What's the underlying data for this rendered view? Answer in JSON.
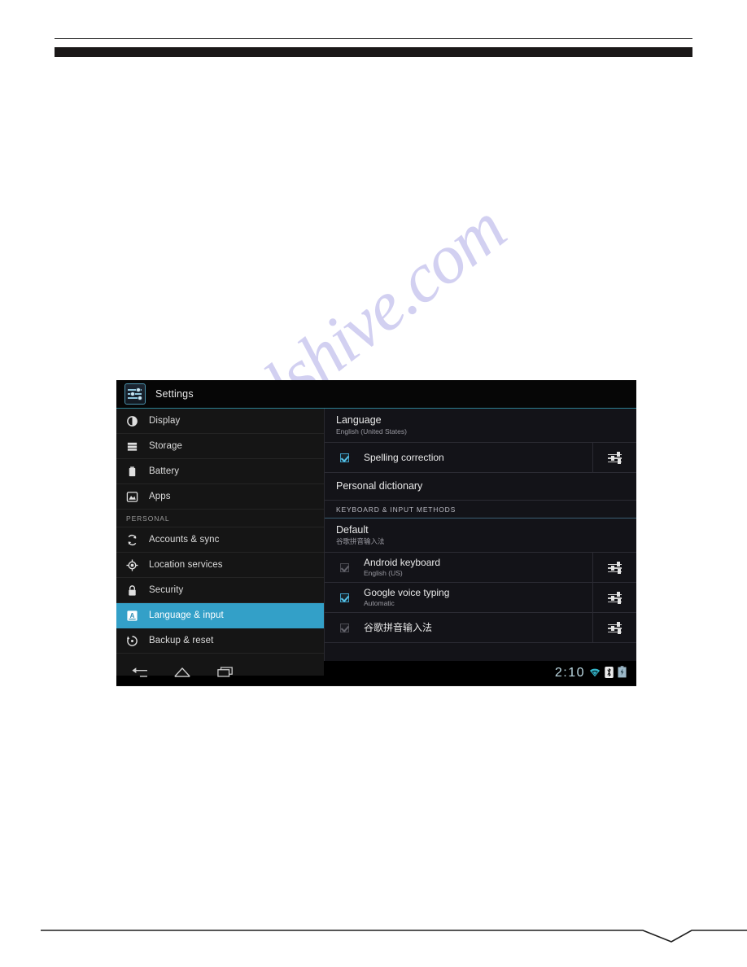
{
  "page": {
    "watermark_text": "manualshive.com"
  },
  "device": {
    "actionbar": {
      "app_icon": "settings-sliders-icon",
      "title": "Settings"
    },
    "sidebar": {
      "items": [
        {
          "label": "Display",
          "icon": "brightness-icon",
          "selected": false
        },
        {
          "label": "Storage",
          "icon": "storage-icon",
          "selected": false
        },
        {
          "label": "Battery",
          "icon": "battery-icon",
          "selected": false
        },
        {
          "label": "Apps",
          "icon": "apps-icon",
          "selected": false
        }
      ],
      "section_label": "PERSONAL",
      "personal_items": [
        {
          "label": "Accounts & sync",
          "icon": "sync-icon",
          "selected": false
        },
        {
          "label": "Location services",
          "icon": "location-icon",
          "selected": false
        },
        {
          "label": "Security",
          "icon": "lock-icon",
          "selected": false
        },
        {
          "label": "Language & input",
          "icon": "language-a-icon",
          "selected": true
        },
        {
          "label": "Backup & reset",
          "icon": "backup-icon",
          "selected": false
        }
      ]
    },
    "content": {
      "language": {
        "title": "Language",
        "subtitle": "English (United States)"
      },
      "spelling": {
        "label": "Spelling correction",
        "checked": true,
        "settings_icon": "sliders-icon"
      },
      "personal_dictionary": "Personal dictionary",
      "keyboard_section": "KEYBOARD & INPUT METHODS",
      "default": {
        "title": "Default",
        "subtitle": "谷歌拼音输入法"
      },
      "methods": [
        {
          "label": "Android keyboard",
          "sublabel": "English (US)",
          "checked": true,
          "dim": true,
          "settings_icon": "sliders-icon"
        },
        {
          "label": "Google voice typing",
          "sublabel": "Automatic",
          "checked": true,
          "dim": false,
          "settings_icon": "sliders-icon"
        },
        {
          "label": "谷歌拼音输入法",
          "sublabel": "",
          "checked": true,
          "dim": true,
          "settings_icon": "sliders-icon"
        }
      ]
    },
    "navbar": {
      "back": "back-icon",
      "home": "home-icon",
      "recents": "recents-icon",
      "clock": "2:10",
      "wifi": "wifi-icon",
      "bluetooth": "bluetooth-icon",
      "battery": "battery-charging-icon"
    }
  },
  "colors": {
    "accent": "#33a0c8",
    "checkbox": "#56c2e8",
    "clock": "#bcd8e2",
    "watermark": "#7670d6"
  }
}
